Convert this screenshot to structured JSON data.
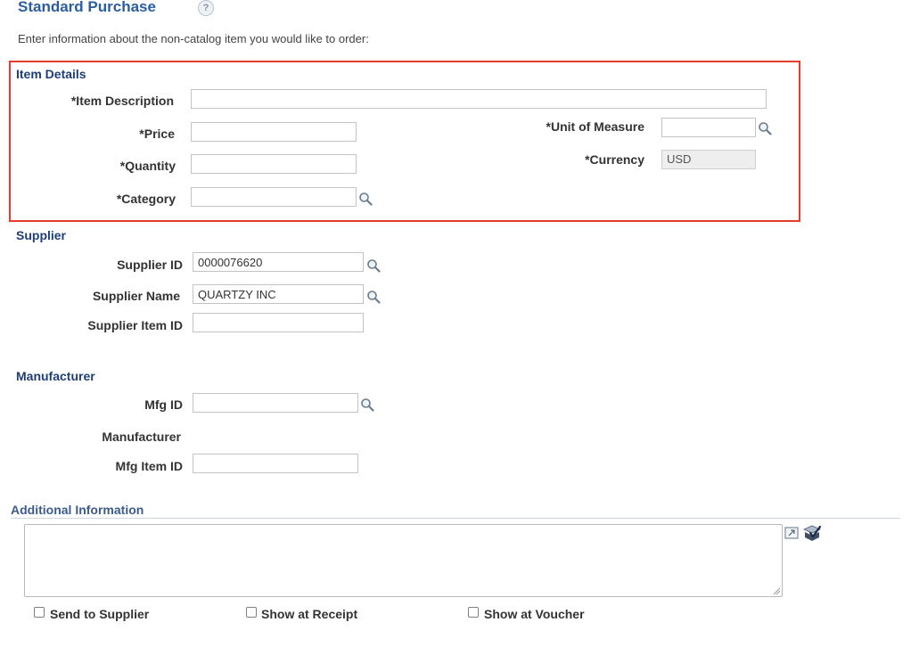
{
  "page": {
    "title": "Standard Purchase",
    "help_glyph": "?",
    "intro": "Enter information about the non-catalog item you would like to order:"
  },
  "item_details": {
    "heading": "Item Details",
    "description_label": "*Item Description",
    "description_value": "",
    "price_label": "*Price",
    "price_value": "",
    "quantity_label": "*Quantity",
    "quantity_value": "",
    "category_label": "*Category",
    "category_value": "",
    "uom_label": "*Unit of Measure",
    "uom_value": "",
    "currency_label": "*Currency",
    "currency_value": "USD"
  },
  "supplier": {
    "heading": "Supplier",
    "id_label": "Supplier ID",
    "id_value": "0000076620",
    "name_label": "Supplier Name",
    "name_value": "QUARTZY INC",
    "item_id_label": "Supplier Item ID",
    "item_id_value": ""
  },
  "manufacturer": {
    "heading": "Manufacturer",
    "mfg_id_label": "Mfg ID",
    "mfg_id_value": "",
    "manufacturer_label": "Manufacturer",
    "mfg_item_id_label": "Mfg Item ID",
    "mfg_item_id_value": ""
  },
  "additional": {
    "heading": "Additional Information",
    "comments_value": "",
    "send_to_supplier_label": "Send to Supplier",
    "send_to_supplier_checked": false,
    "show_at_receipt_label": "Show at Receipt",
    "show_at_receipt_checked": false,
    "show_at_voucher_label": "Show at Voucher",
    "show_at_voucher_checked": false
  },
  "icons": {
    "lookup": "magnifier-lookup-icon",
    "help": "help-question-icon",
    "expand": "expand-textarea-icon",
    "spellcheck": "spell-check-icon"
  },
  "colors": {
    "title": "#2a5ea0",
    "section_heading": "#1f3e78",
    "highlight_border": "#e53b2c"
  }
}
